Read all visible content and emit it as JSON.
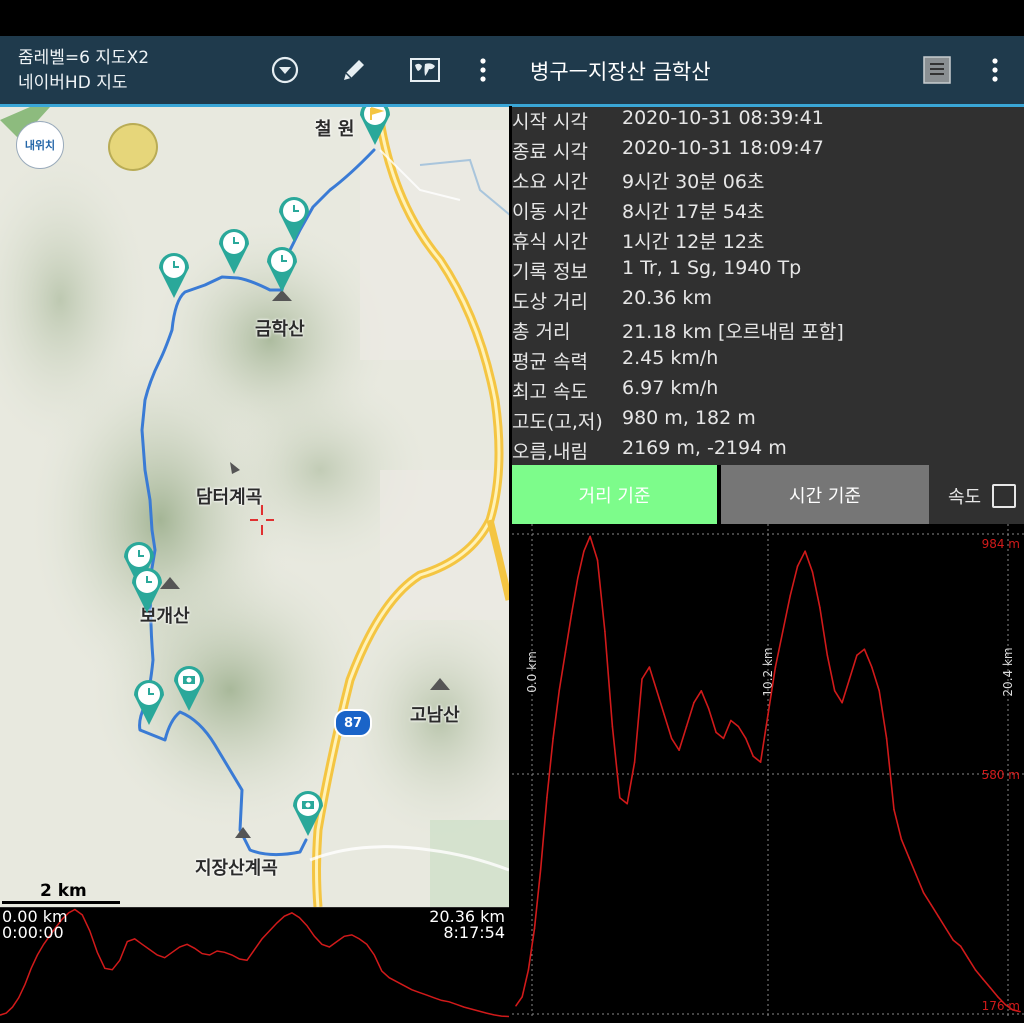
{
  "top_bar": {
    "zoom_label": "줌레벨=6 지도X2",
    "map_name": "네이버HD 지도",
    "title": "병구ㅡ지장산 금학산"
  },
  "icons": {
    "dropdown": "chevron-down-circle-icon",
    "edit": "pencil-icon",
    "map": "world-map-icon",
    "menu_left": "more-vertical-icon",
    "list": "list-icon",
    "menu_right": "more-vertical-icon"
  },
  "map": {
    "my_location_label": "내위치",
    "places": {
      "cheorwon": "철 원",
      "geumhaksan": "금학산",
      "damteo": "담터계곡",
      "bogaesan": "보개산",
      "gonamsan": "고남산",
      "jijangsan": "지장산계곡"
    },
    "road_number": "87",
    "scale": "2 km",
    "route_color": "#3a7bd5",
    "marker_color": "#2aa89a"
  },
  "mini_profile": {
    "start_distance": "0.00 km",
    "start_time": "0:00:00",
    "end_distance": "20.36 km",
    "end_time": "8:17:54"
  },
  "stats": [
    {
      "label": "시작 시각",
      "value": "2020-10-31 08:39:41"
    },
    {
      "label": "종료 시각",
      "value": "2020-10-31 18:09:47"
    },
    {
      "label": "소요 시간",
      "value": "9시간 30분 06초"
    },
    {
      "label": "이동 시간",
      "value": "8시간 17분 54초"
    },
    {
      "label": "휴식 시간",
      "value": "1시간 12분 12초"
    },
    {
      "label": "기록 정보",
      "value": "1 Tr, 1 Sg, 1940 Tp"
    },
    {
      "label": "도상 거리",
      "value": "20.36 km"
    },
    {
      "label": "총 거리",
      "value": "21.18 km [오르내림 포함]"
    },
    {
      "label": "평균 속력",
      "value": "2.45 km/h"
    },
    {
      "label": "최고 속도",
      "value": "6.97 km/h"
    },
    {
      "label": "고도(고,저)",
      "value": "980 m, 182 m"
    },
    {
      "label": "오름,내림",
      "value": "2169 m, -2194 m"
    }
  ],
  "tabs": {
    "distance": "거리 기준",
    "time": "시간 기준",
    "speed_label": "속도",
    "speed_checked": false
  },
  "chart_data": {
    "type": "line",
    "xlabel": "",
    "ylabel": "",
    "x_ticks": [
      "0.0 km",
      "10.2 km",
      "20.4 km"
    ],
    "y_ticks": [
      "984 m",
      "580 m",
      "176 m"
    ],
    "xlim": [
      0,
      20.4
    ],
    "ylim": [
      176,
      984
    ],
    "line_color": "#d11a1a",
    "series": [
      {
        "x": [
          0.0,
          0.25,
          0.5,
          0.75,
          1.0,
          1.25,
          1.5,
          1.75,
          2.0,
          2.25,
          2.5,
          2.75,
          3.0,
          3.3,
          3.6,
          3.9,
          4.2,
          4.5,
          4.8,
          5.1,
          5.4,
          5.7,
          6.0,
          6.3,
          6.6,
          6.9,
          7.2,
          7.5,
          7.8,
          8.1,
          8.4,
          8.7,
          9.0,
          9.3,
          9.6,
          9.9,
          10.2,
          10.5,
          10.8,
          11.1,
          11.4,
          11.7,
          12.0,
          12.3,
          12.6,
          12.9,
          13.2,
          13.5,
          13.8,
          14.1,
          14.4,
          14.7,
          15.0,
          15.3,
          15.6,
          15.9,
          16.2,
          16.5,
          16.8,
          17.1,
          17.4,
          17.7,
          18.0,
          18.3,
          18.6,
          18.9,
          19.2,
          19.5,
          19.8,
          20.1,
          20.4
        ],
        "y": [
          190,
          205,
          250,
          320,
          420,
          540,
          640,
          720,
          785,
          850,
          910,
          955,
          980,
          940,
          820,
          660,
          540,
          530,
          600,
          740,
          760,
          720,
          680,
          640,
          620,
          660,
          700,
          720,
          690,
          650,
          640,
          670,
          660,
          640,
          610,
          600,
          680,
          760,
          820,
          880,
          930,
          955,
          920,
          860,
          780,
          720,
          700,
          740,
          780,
          790,
          760,
          720,
          640,
          520,
          470,
          440,
          410,
          380,
          360,
          340,
          320,
          300,
          290,
          270,
          250,
          235,
          220,
          205,
          192,
          183,
          180
        ]
      }
    ]
  }
}
